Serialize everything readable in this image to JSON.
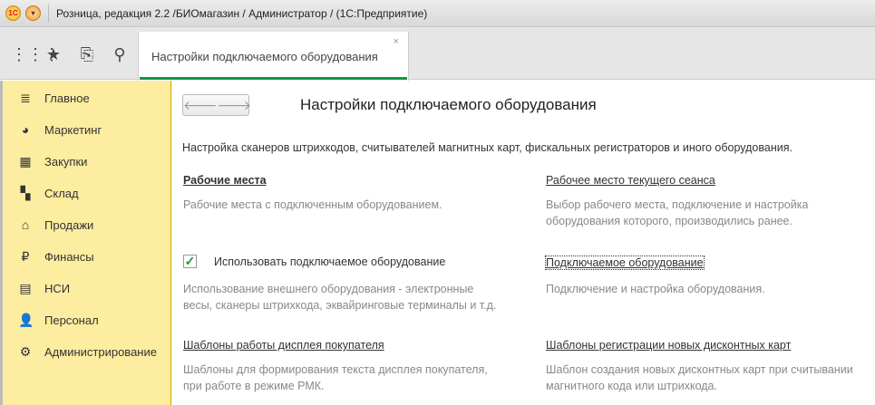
{
  "window": {
    "title": "Розница, редакция 2.2 /БИОмагазин / Администратор /  (1С:Предприятие)",
    "logo": "1С"
  },
  "tab": {
    "label": "Настройки подключаемого оборудования",
    "close": "×"
  },
  "sidebar": {
    "items": [
      {
        "label": "Главное",
        "icon": "≣"
      },
      {
        "label": "Маркетинг",
        "icon": "◕"
      },
      {
        "label": "Закупки",
        "icon": "▦"
      },
      {
        "label": "Склад",
        "icon": "▚"
      },
      {
        "label": "Продажи",
        "icon": "⌂"
      },
      {
        "label": "Финансы",
        "icon": "₽"
      },
      {
        "label": "НСИ",
        "icon": "▤"
      },
      {
        "label": "Персонал",
        "icon": "👤"
      },
      {
        "label": "Администрирование",
        "icon": "⚙"
      }
    ]
  },
  "main": {
    "title": "Настройки подключаемого оборудования",
    "nav": {
      "back": "🡐",
      "forward": "🡒"
    },
    "intro": "Настройка сканеров штрихкодов, считывателей магнитных карт, фискальных регистраторов и иного оборудования.",
    "sections": {
      "workplaces": {
        "link": "Рабочие места",
        "desc": "Рабочие места с подключенным оборудованием."
      },
      "current_workplace": {
        "link": "Рабочее место текущего сеанса",
        "desc": "Выбор рабочего места, подключение и настройка оборудования которого, производились ранее."
      },
      "use_equipment": {
        "label": "Использовать подключаемое оборудование",
        "checked": true,
        "desc": "Использование внешнего оборудования - электронные весы, сканеры штрихкода, эквайринговые терминалы и т.д."
      },
      "equipment": {
        "link": "Подключаемое оборудование",
        "desc": "Подключение и настройка оборудования."
      },
      "display_templates": {
        "link": "Шаблоны работы дисплея покупателя",
        "desc": "Шаблоны для формирования текста дисплея покупателя, при работе в режиме РМК."
      },
      "card_templates": {
        "link": "Шаблоны регистрации новых дисконтных карт",
        "desc": "Шаблон создания новых дисконтных карт при считывании магнитного кода или штрихкода."
      }
    }
  }
}
